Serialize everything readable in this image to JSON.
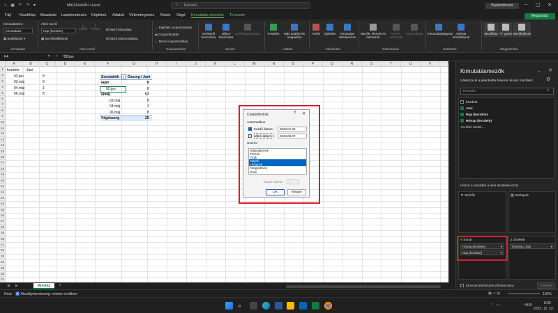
{
  "titlebar": {
    "doc_name": "MAUI2xlsXAt! • Excel",
    "search_placeholder": "Keresés",
    "signin": "Bejelentkezés"
  },
  "menu": [
    "Fájl",
    "Kezdőlap",
    "Beszúrás",
    "Lapelrendezés",
    "Képletek",
    "Adatok",
    "Véleményezés",
    "Nézet",
    "Súgó",
    "Kimutatás-elemzés",
    "Tervezés"
  ],
  "share_label": "Megosztás",
  "ribbon": {
    "kimutatas": {
      "label": "Kimutatásnév:",
      "name": "Kimutatás2",
      "options": "Beállítások",
      "group": "Kimutatás"
    },
    "aktiv": {
      "label": "Aktív mező:",
      "field": "Nap (kezdete)",
      "settings": "Mezőbeállítások",
      "drill_down": "Lefelé",
      "drill_up": "Felfelé",
      "expand": "Mező kibontása",
      "collapse": "Mező összecsukása",
      "group": "Aktív mező"
    },
    "csoport": {
      "b1": "Kijelölés csoportosítása",
      "b2": "Csoportbontás",
      "b3": "Mező csoportosítása",
      "group": "Csoportosítás"
    },
    "szures": {
      "b1": "Szeletelő beszúrása",
      "b2": "Idősor beszúrása",
      "b3": "Szűrőkapcsolatok",
      "group": "Szűrés"
    },
    "adatok": {
      "b1": "Frissítés",
      "b2": "Más adatforrás megadása",
      "group": "Adatok"
    },
    "muveletek": {
      "b1": "Törlés",
      "b2": "Kijelölés",
      "b3": "Kimutatás áthelyezése",
      "group": "Műveletek"
    },
    "szamitasok": {
      "b1": "Mezők, elemek és halmazok",
      "b2": "OLAP-eszközök",
      "b3": "Kapcsolatok",
      "group": "Számítások"
    },
    "eszkozok": {
      "b1": "Kimutatásdiagram",
      "b2": "Ajánlott kimutatások",
      "group": "Eszközök"
    },
    "megjelenites": {
      "b1": "Mezőlista",
      "b2": "+/- gomb",
      "b3": "Mezőfejlécek",
      "group": "Megjelenítés"
    }
  },
  "formula_bar": {
    "cell": "F4",
    "value": "02.jan"
  },
  "columns": [
    "A",
    "B",
    "C",
    "D",
    "E",
    "F",
    "G",
    "H",
    "I",
    "J",
    "K",
    "L",
    "M",
    "N",
    "O",
    "P",
    "Q",
    "R",
    "S",
    "T",
    "U",
    "V",
    "W"
  ],
  "rows": [
    "1",
    "2",
    "3",
    "4",
    "5",
    "6",
    "7",
    "8",
    "9",
    "10",
    "11",
    "12",
    "13",
    "14",
    "15",
    "16",
    "17",
    "18",
    "19",
    "20",
    "21",
    "22",
    "23",
    "24",
    "25",
    "26",
    "27",
    "28",
    "29",
    "30",
    "31",
    "32",
    "33",
    "34",
    "35",
    "36",
    "37"
  ],
  "source_data": {
    "header": [
      "kezdete",
      "Jani"
    ],
    "rows": [
      [
        "02.jan",
        "8"
      ],
      [
        "03.máj",
        "8"
      ],
      [
        "04.máj",
        "1"
      ],
      [
        "06.máj",
        "8"
      ]
    ]
  },
  "pivot": {
    "row_label_hdr": "Sorcímkék",
    "sum_hdr": "Összeg / Jani",
    "rows": [
      {
        "label": "jan",
        "value": "8",
        "level": 0
      },
      {
        "label": "02.jan",
        "value": "8",
        "level": 1
      },
      {
        "label": "máj",
        "value": "57",
        "level": 0
      },
      {
        "label": "03.máj",
        "value": "8",
        "level": 1
      },
      {
        "label": "04.máj",
        "value": "1",
        "level": 1
      },
      {
        "label": "06.máj",
        "value": "8",
        "level": 1
      }
    ],
    "total_label": "Végösszeg",
    "total_value": "25"
  },
  "dialog": {
    "title": "Csoportosítás",
    "auto_label": "Automatikus",
    "start_label": "Kezdő dátum:",
    "start_value": "2023.01.02",
    "end_label": "Záró dátum:",
    "end_value": "2023.05.07",
    "by_label": "Szerint",
    "list": [
      "Másodpercek",
      "Percek",
      "Órák",
      "Napok",
      "Hónapok",
      "Negyedévek",
      "Évek"
    ],
    "days_label": "Napok száma:",
    "days_value": "1",
    "ok": "OK",
    "cancel": "Mégse"
  },
  "sheet_tab": "Munka1",
  "status": {
    "ready": "Kész",
    "accessibility": "Akadálymentesség: minden rendben",
    "zoom": "100%"
  },
  "pane": {
    "title": "Kimutatásmezők",
    "subtitle": "Válassza ki a jelentésbe felvenni kívánt mezőket:",
    "search_placeholder": "Keresés",
    "fields": [
      {
        "name": "kezdete",
        "checked": false
      },
      {
        "name": "Jani",
        "checked": true
      },
      {
        "name": "Nap (kezdete)",
        "checked": true
      },
      {
        "name": "Hónap (kezdete)",
        "checked": true
      }
    ],
    "more_tables": "További táblák...",
    "drag_text": "Húzza a mezőket a lenti területek közé:",
    "filters": "Szűrők",
    "columns": "Oszlopok",
    "rows": "Sorok",
    "values": "Értékek",
    "row_items": [
      "Hónap (kezdete)",
      "Nap (kezdete)"
    ],
    "value_items": [
      "Összeg / Jani"
    ],
    "defer": "Elrendezésfrissítés elhalasztása",
    "update": "Frissítés"
  },
  "taskbar": {
    "lang": "HUN",
    "time": "8:55",
    "date": "2023. 12. 22."
  }
}
